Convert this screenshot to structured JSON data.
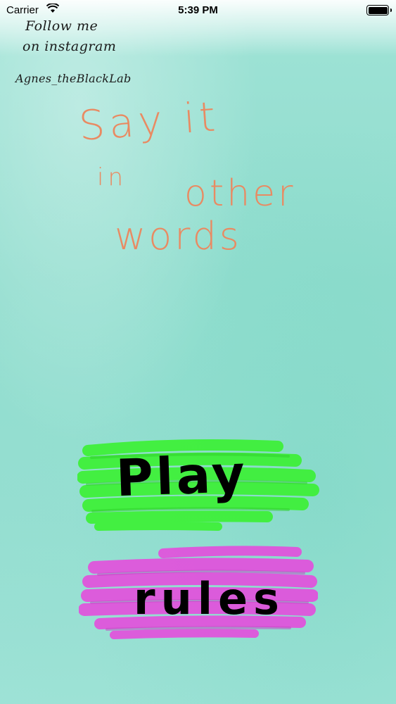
{
  "status_bar": {
    "carrier": "Carrier",
    "time": "5:39 PM"
  },
  "promo": {
    "line1": "Follow me",
    "line2": "on instagram",
    "handle": "Agnes_theBlackLab"
  },
  "title": {
    "line1": "Say it",
    "line2a": "in",
    "line2b": "other",
    "line3": "words"
  },
  "buttons": {
    "play": "Play",
    "rules": "rules"
  },
  "colors": {
    "background": "#94ddd0",
    "title": "#e98a62",
    "play": "#3ff03a",
    "rules": "#e055dc"
  },
  "icons": [
    "wifi-icon",
    "battery-icon"
  ]
}
